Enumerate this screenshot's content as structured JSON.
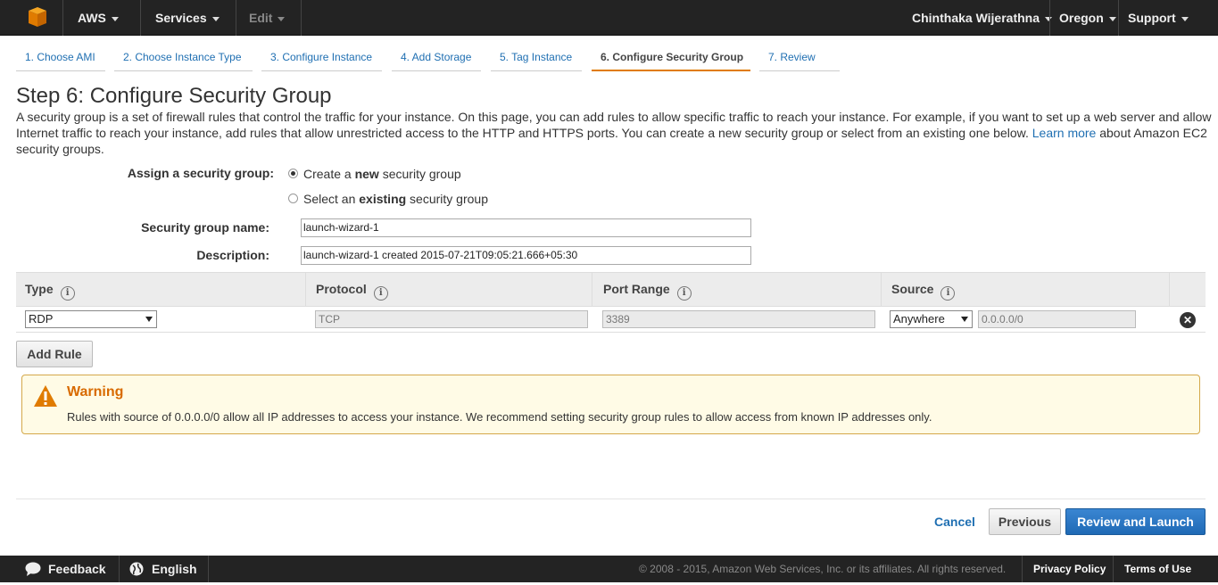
{
  "topbar": {
    "brand": "AWS",
    "services": "Services",
    "edit": "Edit",
    "user": "Chinthaka Wijerathna",
    "region": "Oregon",
    "support": "Support"
  },
  "steps": [
    "1. Choose AMI",
    "2. Choose Instance Type",
    "3. Configure Instance",
    "4. Add Storage",
    "5. Tag Instance",
    "6. Configure Security Group",
    "7. Review"
  ],
  "page": {
    "title": "Step 6: Configure Security Group",
    "intro_part1": "A security group is a set of firewall rules that control the traffic for your instance. On this page, you can add rules to allow specific traffic to reach your instance. For example, if you want to set up a web server and allow Internet traffic to reach your instance, add rules that allow unrestricted access to the HTTP and HTTPS ports. You can create a new security group or select from an existing one below. ",
    "intro_link": "Learn more",
    "intro_part2": " about Amazon EC2 security groups."
  },
  "form": {
    "assign_label": "Assign a security group:",
    "option_new_pre": "Create a ",
    "option_new_bold": "new",
    "option_new_post": " security group",
    "option_existing_pre": "Select an ",
    "option_existing_bold": "existing",
    "option_existing_post": " security group",
    "name_label": "Security group name:",
    "name_value": "launch-wizard-1",
    "desc_label": "Description:",
    "desc_value": "launch-wizard-1 created 2015-07-21T09:05:21.666+05:30"
  },
  "table": {
    "headers": [
      "Type",
      "Protocol",
      "Port Range",
      "Source"
    ],
    "row": {
      "type": "RDP",
      "protocol": "TCP",
      "port_range": "3389",
      "source": "Anywhere",
      "cidr": "0.0.0.0/0"
    }
  },
  "buttons": {
    "add_rule": "Add Rule",
    "cancel": "Cancel",
    "previous": "Previous",
    "review_launch": "Review and Launch"
  },
  "warning": {
    "title": "Warning",
    "text": "Rules with source of 0.0.0.0/0 allow all IP addresses to access your instance. We recommend setting security group rules to allow access from known IP addresses only."
  },
  "footer": {
    "feedback": "Feedback",
    "language": "English",
    "copyright": "© 2008 - 2015, Amazon Web Services, Inc. or its affiliates. All rights reserved.",
    "privacy": "Privacy Policy",
    "terms": "Terms of Use"
  },
  "colors": {
    "accent_orange": "#e07b00",
    "link_blue": "#1f6fb2",
    "primary_button": "#1f6ab5"
  }
}
